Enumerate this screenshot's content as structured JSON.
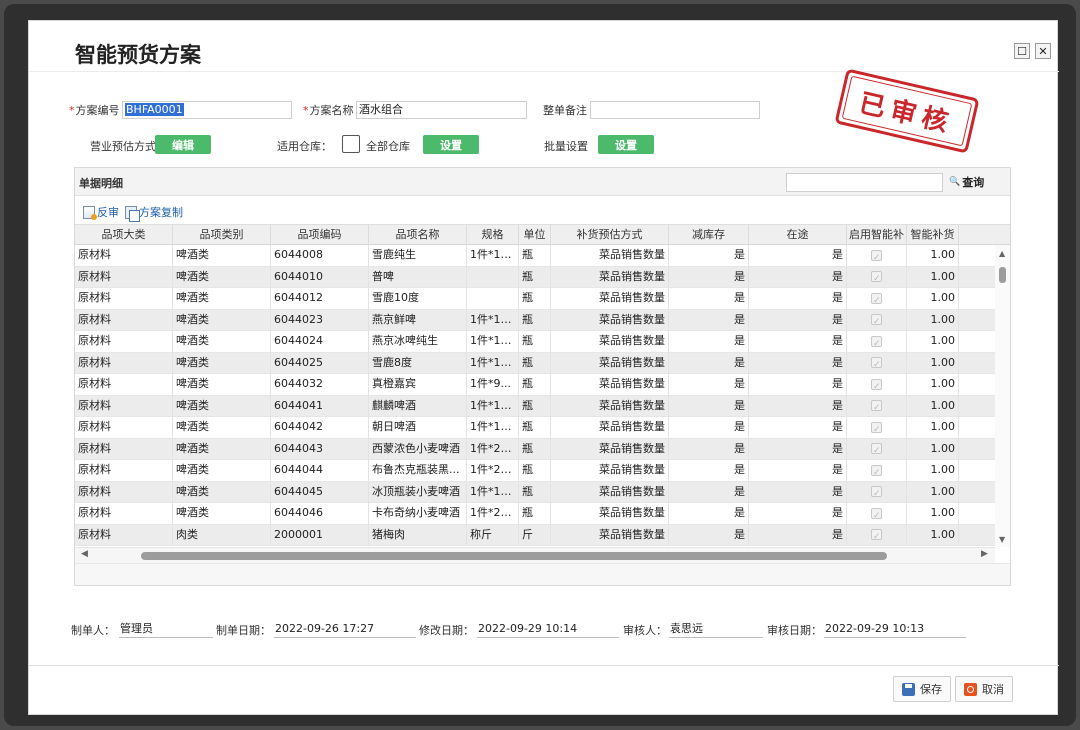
{
  "window": {
    "title": "智能预货方案",
    "maximize_glyph": "☐",
    "close_glyph": "✕"
  },
  "form": {
    "plan_no_label": "方案编号",
    "plan_no_value": "BHFA0001",
    "plan_name_label": "方案名称",
    "plan_name_value": "酒水组合",
    "remark_label": "整单备注",
    "remark_value": "",
    "forecast_label": "营业预估方式",
    "forecast_button": "编辑",
    "warehouse_label": "适用仓库：",
    "all_warehouse_label": "全部仓库",
    "warehouse_button": "设置",
    "batch_label": "批量设置",
    "batch_button": "设置"
  },
  "stamp": {
    "text": "已审核",
    "color": "#c9272b"
  },
  "panel": {
    "title": "单据明细",
    "search_button": "查询",
    "search_icon_glyph": "🔍",
    "toolbar": {
      "reverse": "反审",
      "copy": "方案复制"
    }
  },
  "table": {
    "headers": [
      "品项大类",
      "品项类别",
      "品项编码",
      "品项名称",
      "规格",
      "单位",
      "补货预估方式",
      "减库存",
      "在途",
      "启用智能补",
      "智能补货"
    ],
    "rows": [
      [
        "原材料",
        "啤酒类",
        "6044008",
        "雪鹿纯生",
        "1件*12...",
        "瓶",
        "菜品销售数量",
        "是",
        "是",
        "",
        "1.00"
      ],
      [
        "原材料",
        "啤酒类",
        "6044010",
        "普啤",
        "",
        "瓶",
        "菜品销售数量",
        "是",
        "是",
        "",
        "1.00"
      ],
      [
        "原材料",
        "啤酒类",
        "6044012",
        "雪鹿10度",
        "",
        "瓶",
        "菜品销售数量",
        "是",
        "是",
        "",
        "1.00"
      ],
      [
        "原材料",
        "啤酒类",
        "6044023",
        "燕京鲜啤",
        "1件*12...",
        "瓶",
        "菜品销售数量",
        "是",
        "是",
        "",
        "1.00"
      ],
      [
        "原材料",
        "啤酒类",
        "6044024",
        "燕京冰啤纯生",
        "1件*12...",
        "瓶",
        "菜品销售数量",
        "是",
        "是",
        "",
        "1.00"
      ],
      [
        "原材料",
        "啤酒类",
        "6044025",
        "雪鹿8度",
        "1件*12...",
        "瓶",
        "菜品销售数量",
        "是",
        "是",
        "",
        "1.00"
      ],
      [
        "原材料",
        "啤酒类",
        "6044032",
        "真橙嘉宾",
        "1件*9...",
        "瓶",
        "菜品销售数量",
        "是",
        "是",
        "",
        "1.00"
      ],
      [
        "原材料",
        "啤酒类",
        "6044041",
        "麒麟啤酒",
        "1件*12...",
        "瓶",
        "菜品销售数量",
        "是",
        "是",
        "",
        "1.00"
      ],
      [
        "原材料",
        "啤酒类",
        "6044042",
        "朝日啤酒",
        "1件*12...",
        "瓶",
        "菜品销售数量",
        "是",
        "是",
        "",
        "1.00"
      ],
      [
        "原材料",
        "啤酒类",
        "6044043",
        "西蒙浓色小麦啤酒",
        "1件*20...",
        "瓶",
        "菜品销售数量",
        "是",
        "是",
        "",
        "1.00"
      ],
      [
        "原材料",
        "啤酒类",
        "6044044",
        "布鲁杰克瓶装黑...",
        "1件*20...",
        "瓶",
        "菜品销售数量",
        "是",
        "是",
        "",
        "1.00"
      ],
      [
        "原材料",
        "啤酒类",
        "6044045",
        "冰顶瓶装小麦啤酒",
        "1件*12...",
        "瓶",
        "菜品销售数量",
        "是",
        "是",
        "",
        "1.00"
      ],
      [
        "原材料",
        "啤酒类",
        "6044046",
        "卡布奇纳小麦啤酒",
        "1件*20...",
        "瓶",
        "菜品销售数量",
        "是",
        "是",
        "",
        "1.00"
      ],
      [
        "原材料",
        "肉类",
        "2000001",
        "猪梅肉",
        "称斤",
        "斤",
        "菜品销售数量",
        "是",
        "是",
        "",
        "1.00"
      ]
    ]
  },
  "footer": {
    "creator_label": "制单人：",
    "creator_value": "管理员",
    "created_label": "制单日期：",
    "created_value": "2022-09-26 17:27",
    "modified_label": "修改日期：",
    "modified_value": "2022-09-29 10:14",
    "auditor_label": "审核人：",
    "auditor_value": "袁思远",
    "audit_date_label": "审核日期：",
    "audit_date_value": "2022-09-29 10:13"
  },
  "actions": {
    "save": "保存",
    "cancel": "取消"
  },
  "colors": {
    "green_button": "#4cba6b",
    "selection": "#2f6fd6",
    "link": "#1c5fa8"
  }
}
